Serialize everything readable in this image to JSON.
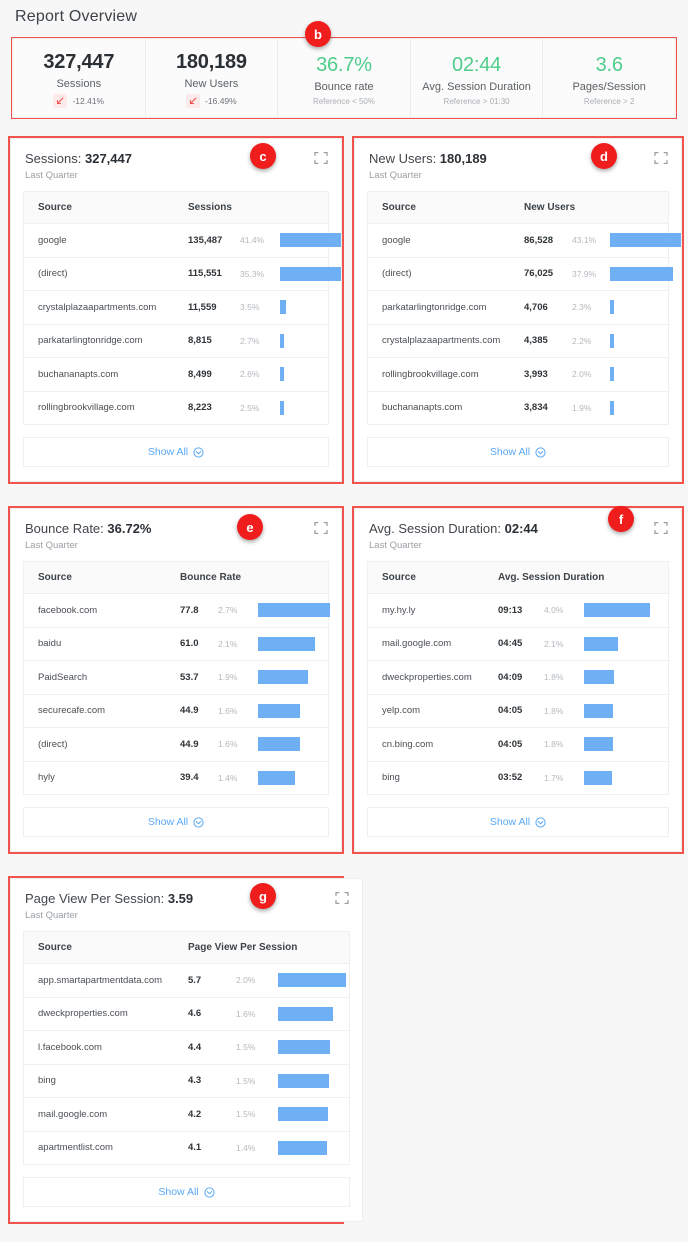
{
  "page": {
    "title": "Report Overview",
    "background": "#f7f7f7",
    "accent_bar": "#6fb0f5",
    "annotation_red": "#f2534c",
    "good_green": "#4ecd8a"
  },
  "annotations": [
    {
      "key": "b",
      "label": "b"
    },
    {
      "key": "c",
      "label": "c"
    },
    {
      "key": "d",
      "label": "d"
    },
    {
      "key": "e",
      "label": "e"
    },
    {
      "key": "f",
      "label": "f"
    },
    {
      "key": "g",
      "label": "g"
    }
  ],
  "kpis": [
    {
      "value": "327,447",
      "label": "Sessions",
      "delta": "-12.41%",
      "direction": "down",
      "sub": ""
    },
    {
      "value": "180,189",
      "label": "New Users",
      "delta": "-16.49%",
      "direction": "down",
      "sub": ""
    },
    {
      "value": "36.7%",
      "label": "Bounce rate",
      "delta": "",
      "direction": "good",
      "sub": "Reference < 50%"
    },
    {
      "value": "02:44",
      "label": "Avg. Session Duration",
      "delta": "",
      "direction": "good",
      "sub": "Reference > 01:30"
    },
    {
      "value": "3.6",
      "label": "Pages/Session",
      "delta": "",
      "direction": "good",
      "sub": "Reference > 2"
    }
  ],
  "common": {
    "subtitle": "Last Quarter",
    "source_header": "Source",
    "show_all": "Show All",
    "expand_icon": "expand-icon",
    "chevron_icon": "chevron-down-circle-icon"
  },
  "cards": [
    {
      "id": "sessions",
      "title_prefix": "Sessions: ",
      "title_value": "327,447",
      "subtitle": "Last Quarter",
      "metric_header": "Sessions",
      "show_all": "Show All",
      "rows": [
        {
          "source": "google",
          "value": "135,487",
          "pct": "41.4%",
          "bar": 100
        },
        {
          "source": "(direct)",
          "value": "115,551",
          "pct": "35.3%",
          "bar": 85
        },
        {
          "source": "crystalplazaapartments.com",
          "value": "11,559",
          "pct": "3.5%",
          "bar": 8
        },
        {
          "source": "parkatarlingtonridge.com",
          "value": "8,815",
          "pct": "2.7%",
          "bar": 6
        },
        {
          "source": "buchananapts.com",
          "value": "8,499",
          "pct": "2.6%",
          "bar": 6
        },
        {
          "source": "rollingbrookvillage.com",
          "value": "8,223",
          "pct": "2.5%",
          "bar": 6
        }
      ]
    },
    {
      "id": "new-users",
      "title_prefix": "New Users: ",
      "title_value": "180,189",
      "subtitle": "Last Quarter",
      "metric_header": "New Users",
      "show_all": "Show All",
      "rows": [
        {
          "source": "google",
          "value": "86,528",
          "pct": "43.1%",
          "bar": 100
        },
        {
          "source": "(direct)",
          "value": "76,025",
          "pct": "37.9%",
          "bar": 88
        },
        {
          "source": "parkatarlingtonridge.com",
          "value": "4,706",
          "pct": "2.3%",
          "bar": 6
        },
        {
          "source": "crystalplazaapartments.com",
          "value": "4,385",
          "pct": "2.2%",
          "bar": 6
        },
        {
          "source": "rollingbrookvillage.com",
          "value": "3,993",
          "pct": "2.0%",
          "bar": 6
        },
        {
          "source": "buchananapts.com",
          "value": "3,834",
          "pct": "1.9%",
          "bar": 6
        }
      ]
    },
    {
      "id": "bounce-rate",
      "title_prefix": "Bounce Rate: ",
      "title_value": "36.72%",
      "subtitle": "Last Quarter",
      "metric_header": "Bounce Rate",
      "show_all": "Show All",
      "rows": [
        {
          "source": "facebook.com",
          "value": "77.8",
          "pct": "2.7%",
          "bar": 100
        },
        {
          "source": "baidu",
          "value": "61.0",
          "pct": "2.1%",
          "bar": 79
        },
        {
          "source": "PaidSearch",
          "value": "53.7",
          "pct": "1.9%",
          "bar": 70
        },
        {
          "source": "securecafe.com",
          "value": "44.9",
          "pct": "1.6%",
          "bar": 58
        },
        {
          "source": "(direct)",
          "value": "44.9",
          "pct": "1.6%",
          "bar": 58
        },
        {
          "source": "hyly",
          "value": "39.4",
          "pct": "1.4%",
          "bar": 51
        }
      ]
    },
    {
      "id": "avg-session-duration",
      "title_prefix": "Avg. Session Duration: ",
      "title_value": "02:44",
      "subtitle": "Last Quarter",
      "metric_header": "Avg. Session Duration",
      "show_all": "Show All",
      "rows": [
        {
          "source": "my.hy.ly",
          "value": "09:13",
          "pct": "4.0%",
          "bar": 100
        },
        {
          "source": "mail.google.com",
          "value": "04:45",
          "pct": "2.1%",
          "bar": 52
        },
        {
          "source": "dweckproperties.com",
          "value": "04:09",
          "pct": "1.8%",
          "bar": 45
        },
        {
          "source": "yelp.com",
          "value": "04:05",
          "pct": "1.8%",
          "bar": 44
        },
        {
          "source": "cn.bing.com",
          "value": "04:05",
          "pct": "1.8%",
          "bar": 44
        },
        {
          "source": "bing",
          "value": "03:52",
          "pct": "1.7%",
          "bar": 42
        }
      ]
    },
    {
      "id": "page-view-per-session",
      "title_prefix": "Page View Per Session: ",
      "title_value": "3.59",
      "subtitle": "Last Quarter",
      "metric_header": "Page View Per Session",
      "show_all": "Show All",
      "rows": [
        {
          "source": "app.smartapartmentdata.com",
          "value": "5.7",
          "pct": "2.0%",
          "bar": 100
        },
        {
          "source": "dweckproperties.com",
          "value": "4.6",
          "pct": "1.6%",
          "bar": 81
        },
        {
          "source": "l.facebook.com",
          "value": "4.4",
          "pct": "1.5%",
          "bar": 77
        },
        {
          "source": "bing",
          "value": "4.3",
          "pct": "1.5%",
          "bar": 75
        },
        {
          "source": "mail.google.com",
          "value": "4.2",
          "pct": "1.5%",
          "bar": 74
        },
        {
          "source": "apartmentlist.com",
          "value": "4.1",
          "pct": "1.4%",
          "bar": 72
        }
      ]
    }
  ],
  "chart_data": [
    {
      "type": "bar",
      "title": "Sessions: 327,447",
      "xlabel": "Source",
      "ylabel": "Sessions",
      "categories": [
        "google",
        "(direct)",
        "crystalplazaapartments.com",
        "parkatarlingtonridge.com",
        "buchananapts.com",
        "rollingbrookvillage.com"
      ],
      "values": [
        135487,
        115551,
        11559,
        8815,
        8499,
        8223
      ],
      "share_pct": [
        41.4,
        35.3,
        3.5,
        2.7,
        2.6,
        2.5
      ]
    },
    {
      "type": "bar",
      "title": "New Users: 180,189",
      "xlabel": "Source",
      "ylabel": "New Users",
      "categories": [
        "google",
        "(direct)",
        "parkatarlingtonridge.com",
        "crystalplazaapartments.com",
        "rollingbrookvillage.com",
        "buchananapts.com"
      ],
      "values": [
        86528,
        76025,
        4706,
        4385,
        3993,
        3834
      ],
      "share_pct": [
        43.1,
        37.9,
        2.3,
        2.2,
        2.0,
        1.9
      ]
    },
    {
      "type": "bar",
      "title": "Bounce Rate: 36.72%",
      "xlabel": "Source",
      "ylabel": "Bounce Rate",
      "categories": [
        "facebook.com",
        "baidu",
        "PaidSearch",
        "securecafe.com",
        "(direct)",
        "hyly"
      ],
      "values": [
        77.8,
        61.0,
        53.7,
        44.9,
        44.9,
        39.4
      ],
      "share_pct": [
        2.7,
        2.1,
        1.9,
        1.6,
        1.6,
        1.4
      ]
    },
    {
      "type": "bar",
      "title": "Avg. Session Duration: 02:44",
      "xlabel": "Source",
      "ylabel": "Avg. Session Duration",
      "categories": [
        "my.hy.ly",
        "mail.google.com",
        "dweckproperties.com",
        "yelp.com",
        "cn.bing.com",
        "bing"
      ],
      "values": [
        "09:13",
        "04:45",
        "04:09",
        "04:05",
        "04:05",
        "03:52"
      ],
      "share_pct": [
        4.0,
        2.1,
        1.8,
        1.8,
        1.8,
        1.7
      ]
    },
    {
      "type": "bar",
      "title": "Page View Per Session: 3.59",
      "xlabel": "Source",
      "ylabel": "Page View Per Session",
      "categories": [
        "app.smartapartmentdata.com",
        "dweckproperties.com",
        "l.facebook.com",
        "bing",
        "mail.google.com",
        "apartmentlist.com"
      ],
      "values": [
        5.7,
        4.6,
        4.4,
        4.3,
        4.2,
        4.1
      ],
      "share_pct": [
        2.0,
        1.6,
        1.5,
        1.5,
        1.5,
        1.4
      ]
    }
  ]
}
